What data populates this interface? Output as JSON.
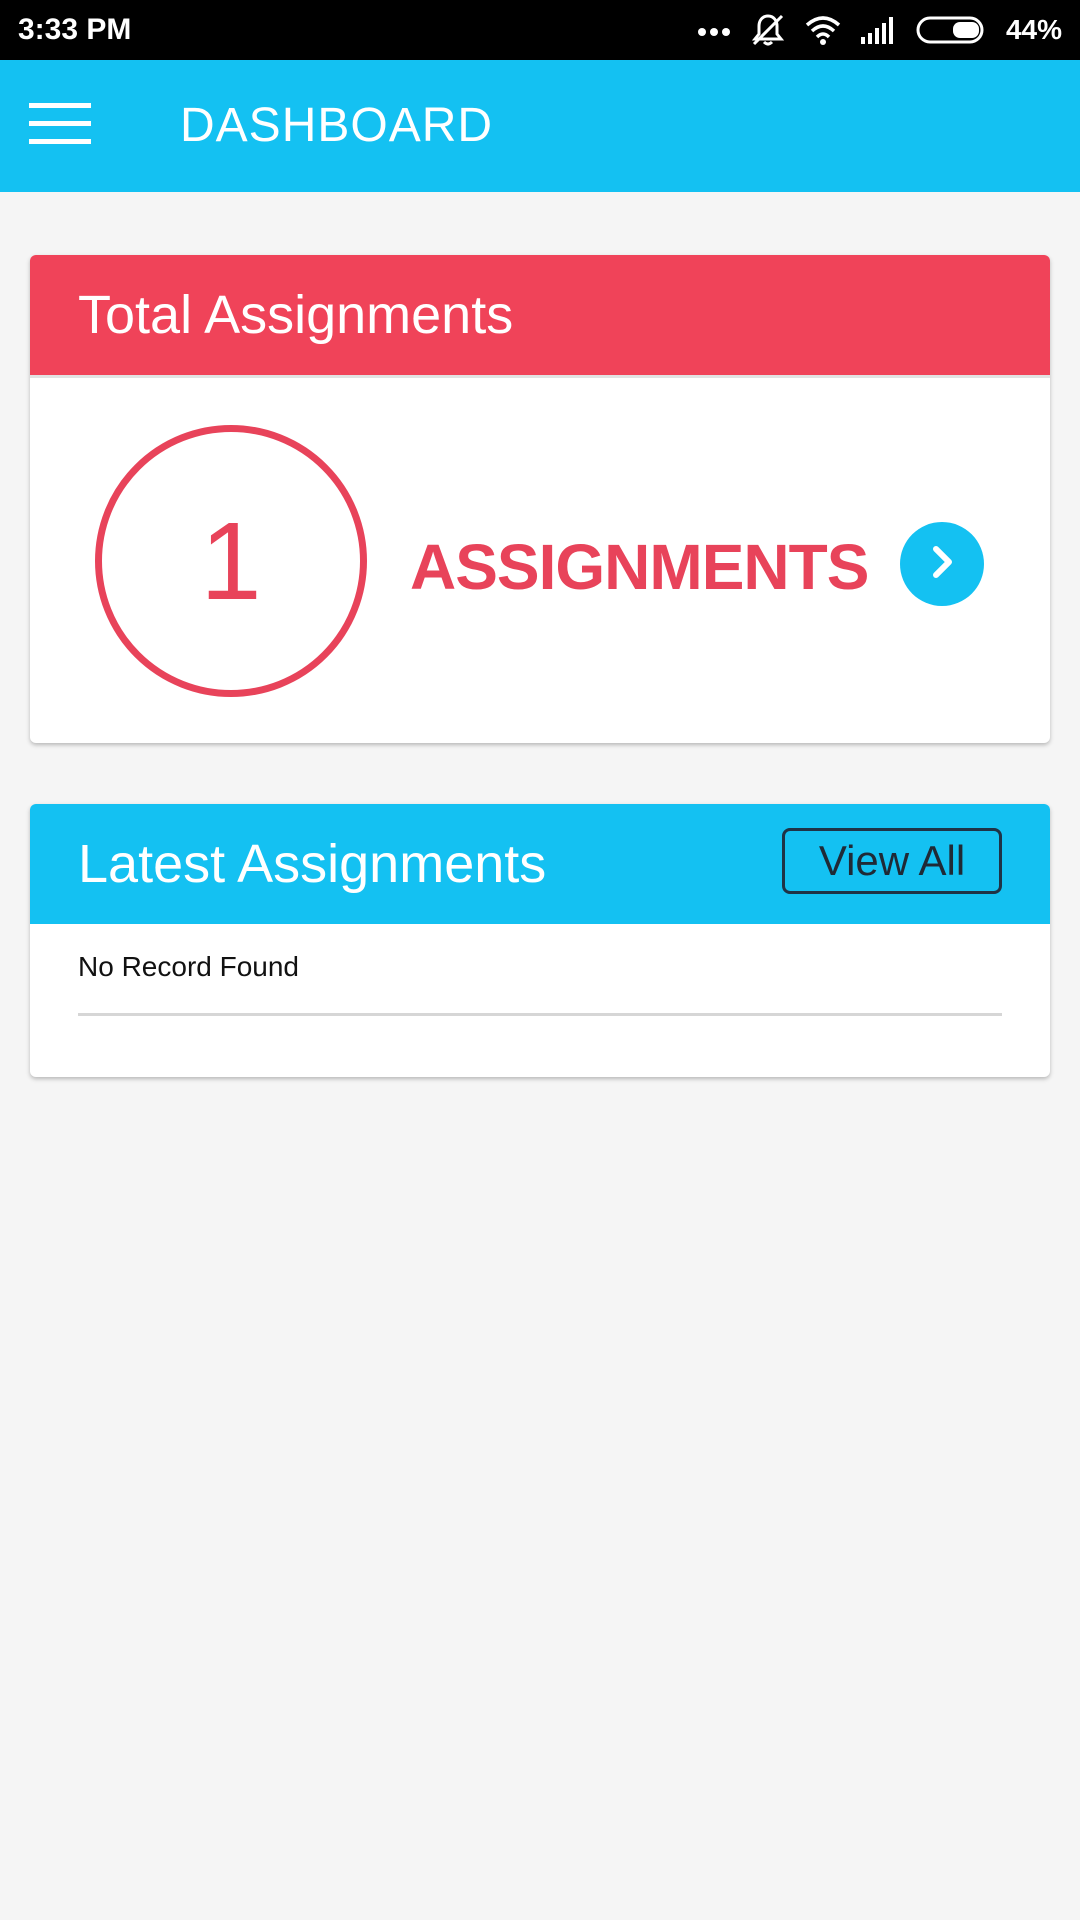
{
  "status_bar": {
    "time": "3:33 PM",
    "battery": "44%",
    "icons": [
      "more-dots-icon",
      "mute-icon",
      "wifi-icon",
      "signal-icon",
      "battery-icon"
    ]
  },
  "app_bar": {
    "title": "DASHBOARD",
    "menu_icon": "hamburger-icon"
  },
  "total_card": {
    "title": "Total Assignments",
    "count": "1",
    "label": "ASSIGNMENTS",
    "go_icon": "chevron-right-icon"
  },
  "latest_card": {
    "title": "Latest Assignments",
    "view_all_label": "View All",
    "empty_text": "No Record Found"
  },
  "colors": {
    "primary": "#14c1f2",
    "accent": "#f04359",
    "background": "#f5f5f5"
  }
}
